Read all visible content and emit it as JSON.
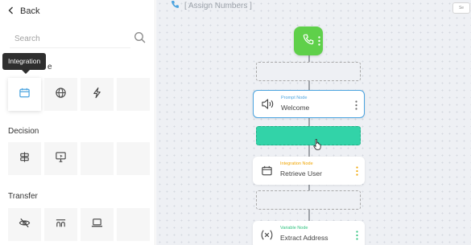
{
  "sidebar": {
    "back_label": "Back",
    "search_placeholder": "Search",
    "tooltip": "Integration",
    "tooltip_hidden_suffix": "e",
    "sections": [
      {
        "title": "",
        "tiles": [
          {
            "icon": "calendar-icon"
          },
          {
            "icon": "globe-icon"
          },
          {
            "icon": "lightning-icon"
          },
          {
            "icon": ""
          }
        ]
      },
      {
        "title": "Decision",
        "tiles": [
          {
            "icon": "signpost-icon"
          },
          {
            "icon": "monitor-pointer-icon"
          },
          {
            "icon": ""
          },
          {
            "icon": ""
          }
        ]
      },
      {
        "title": "Transfer",
        "tiles": [
          {
            "icon": "eye-off-icon"
          },
          {
            "icon": "arch-icon"
          },
          {
            "icon": "laptop-icon"
          },
          {
            "icon": ""
          }
        ]
      }
    ]
  },
  "flow": {
    "title": "[ Assign Numbers ]",
    "minimap_label": "Se",
    "nodes": [
      {
        "type_label": "Prompt Node",
        "name": "Welcome",
        "type_color": "#4aa3df",
        "icon": "speaker-icon"
      },
      {
        "type_label": "Integration Node",
        "name": "Retrieve User",
        "type_color": "#f0a500",
        "icon": "calendar-icon"
      },
      {
        "type_label": "Variable Node",
        "name": "Extract Address",
        "type_color": "#2ec27e",
        "icon": "variable-icon"
      }
    ]
  },
  "colors": {
    "start_node": "#5fd04a",
    "drop_highlight": "#32d3a8",
    "selected_border": "#4aa3df",
    "flow_title": "#9aa0a8"
  }
}
